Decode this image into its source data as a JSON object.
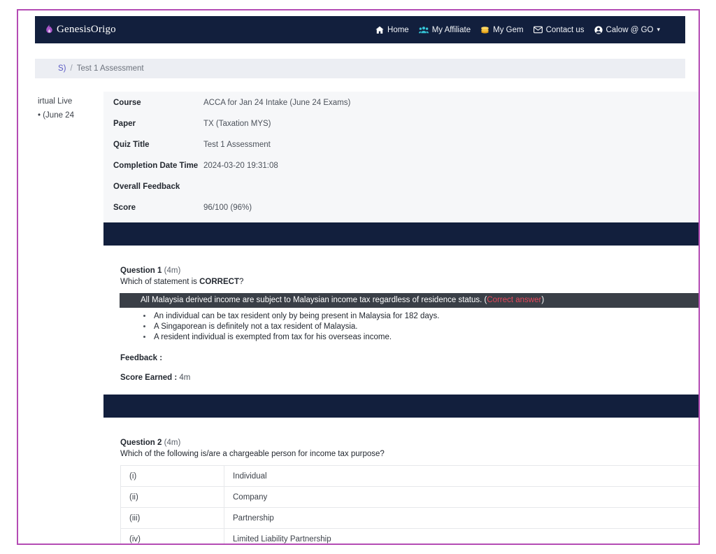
{
  "brand": {
    "name": "GenesisOrigo",
    "logo_icon": "flame-icon",
    "accent": "#a855c8"
  },
  "navbar": {
    "background": "#121f3d",
    "links": [
      {
        "label": "Home",
        "icon": "home-icon"
      },
      {
        "label": "My Affiliate",
        "icon": "people-group-icon"
      },
      {
        "label": "My Gem",
        "icon": "coin-stack-icon"
      },
      {
        "label": "Contact us",
        "icon": "envelope-icon"
      },
      {
        "label": "Calow @ GO",
        "icon": "user-circle-icon",
        "caret": "▾"
      }
    ]
  },
  "breadcrumb": {
    "truncated_parent": "S)",
    "separator": "/",
    "current": "Test 1 Assessment"
  },
  "sidebar": {
    "clipped_lines": [
      "irtual Live",
      "• (June 24"
    ]
  },
  "info": {
    "rows": [
      {
        "label": "Course",
        "value": "ACCA for Jan 24 Intake (June 24 Exams)"
      },
      {
        "label": "Paper",
        "value": "TX (Taxation MYS)"
      },
      {
        "label": "Quiz Title",
        "value": "Test 1 Assessment"
      },
      {
        "label": "Completion Date Time",
        "value": "2024-03-20 19:31:08"
      },
      {
        "label": "Overall Feedback",
        "value": ""
      },
      {
        "label": "Score",
        "value": "96/100  (96%)"
      }
    ]
  },
  "questions": [
    {
      "number": "Question 1",
      "marks": "(4m)",
      "prompt_before": "Which of statement is ",
      "prompt_bold": "CORRECT",
      "prompt_after": "?",
      "correct_answer": "All Malaysia derived income are subject to Malaysian income tax regardless of residence status. (",
      "correct_tag": "Correct answer",
      "correct_close": ")",
      "other_answers": [
        "An individual can be tax resident only by being present in Malaysia for 182 days.",
        "A Singaporean is definitely not a tax resident of Malaysia.",
        "A resident individual is exempted from tax for his overseas income."
      ],
      "feedback_label": "Feedback :",
      "feedback_value": "",
      "score_label": "Score Earned :",
      "score_value": "4m"
    },
    {
      "number": "Question 2",
      "marks": "(4m)",
      "prompt": "Which of the following is/are a chargeable person for income tax purpose?",
      "statements": [
        {
          "roman": "(i)",
          "text": "Individual"
        },
        {
          "roman": "(ii)",
          "text": "Company"
        },
        {
          "roman": "(iii)",
          "text": "Partnership"
        },
        {
          "roman": "(iv)",
          "text": "Limited Liability Partnership"
        }
      ]
    }
  ],
  "colors": {
    "navy": "#121f3d",
    "page_border": "#b44bb4",
    "correct_row_bg": "#3a3f47",
    "correct_tag": "#e8485c",
    "panel_bg": "#f6f7f9"
  }
}
